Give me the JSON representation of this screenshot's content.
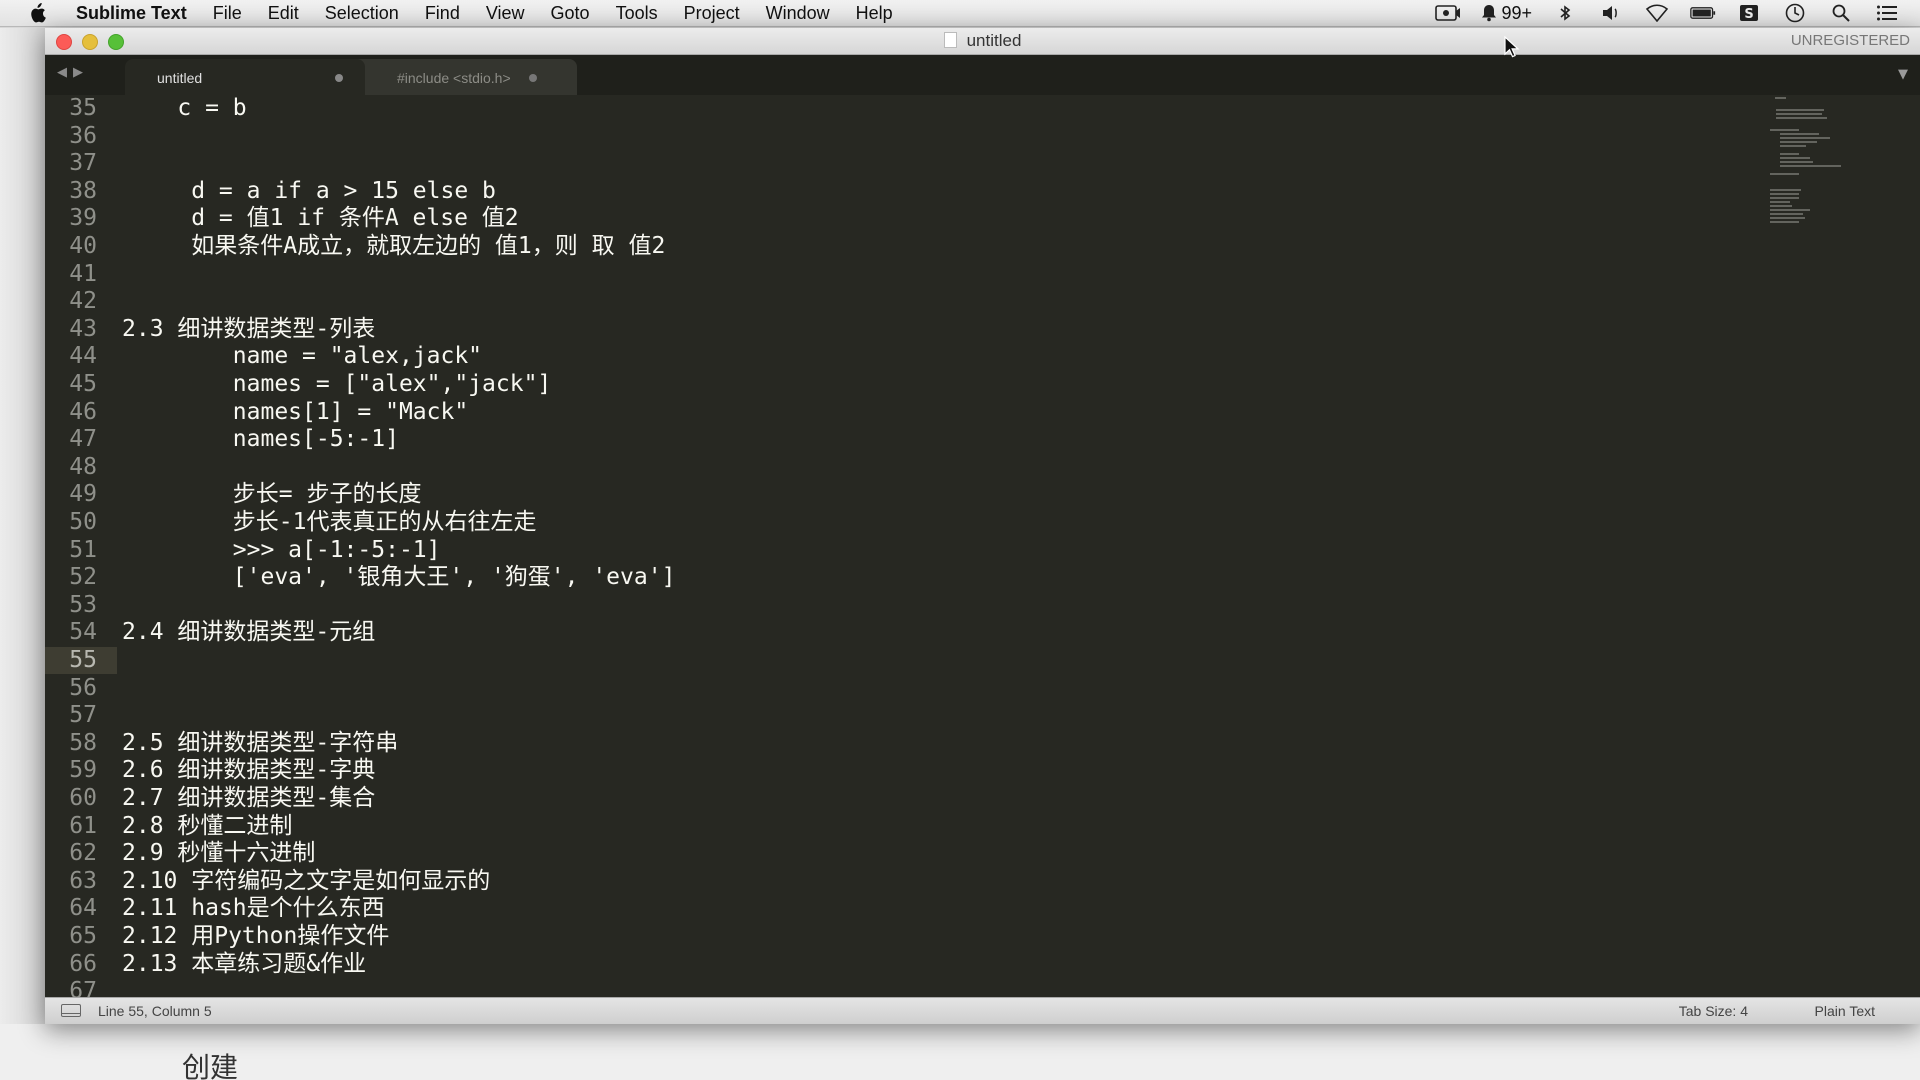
{
  "menubar": {
    "app_name": "Sublime Text",
    "items": [
      "File",
      "Edit",
      "Selection",
      "Find",
      "View",
      "Goto",
      "Tools",
      "Project",
      "Window",
      "Help"
    ],
    "status_icons": [
      "screen-record-icon",
      "notification-bell-icon",
      "bluetooth-icon",
      "volume-icon",
      "wifi-icon",
      "battery-icon",
      "s-app-icon",
      "clock-icon",
      "spotlight-search-icon",
      "notification-center-icon"
    ],
    "notification_count": "99+"
  },
  "window": {
    "title": "untitled",
    "registration": "UNREGISTERED"
  },
  "tabs": [
    {
      "label": "untitled",
      "active": true
    },
    {
      "label": "#include <stdio.h>",
      "active": false
    }
  ],
  "editor": {
    "current_line": 55,
    "lines": [
      {
        "n": "35",
        "text": "    c = b"
      },
      {
        "n": "36",
        "text": ""
      },
      {
        "n": "37",
        "text": ""
      },
      {
        "n": "38",
        "text": "     d = a if a > 15 else b"
      },
      {
        "n": "39",
        "text": "     d = 值1 if 条件A else 值2"
      },
      {
        "n": "40",
        "text": "     如果条件A成立，就取左边的 值1，则 取 值2"
      },
      {
        "n": "41",
        "text": ""
      },
      {
        "n": "42",
        "text": ""
      },
      {
        "n": "43",
        "text": "2.3 细讲数据类型-列表"
      },
      {
        "n": "44",
        "text": "        name = \"alex,jack\""
      },
      {
        "n": "45",
        "text": "        names = [\"alex\",\"jack\"]"
      },
      {
        "n": "46",
        "text": "        names[1] = \"Mack\""
      },
      {
        "n": "47",
        "text": "        names[-5:-1]"
      },
      {
        "n": "48",
        "text": ""
      },
      {
        "n": "49",
        "text": "        步长= 步子的长度"
      },
      {
        "n": "50",
        "text": "        步长-1代表真正的从右往左走"
      },
      {
        "n": "51",
        "text": "        >>> a[-1:-5:-1]"
      },
      {
        "n": "52",
        "text": "        ['eva', '银角大王', '狗蛋', 'eva']"
      },
      {
        "n": "53",
        "text": ""
      },
      {
        "n": "54",
        "text": "2.4 细讲数据类型-元组"
      },
      {
        "n": "55",
        "text": ""
      },
      {
        "n": "56",
        "text": ""
      },
      {
        "n": "57",
        "text": ""
      },
      {
        "n": "58",
        "text": "2.5 细讲数据类型-字符串"
      },
      {
        "n": "59",
        "text": "2.6 细讲数据类型-字典"
      },
      {
        "n": "60",
        "text": "2.7 细讲数据类型-集合"
      },
      {
        "n": "61",
        "text": "2.8 秒懂二进制"
      },
      {
        "n": "62",
        "text": "2.9 秒懂十六进制"
      },
      {
        "n": "63",
        "text": "2.10 字符编码之文字是如何显示的"
      },
      {
        "n": "64",
        "text": "2.11 hash是个什么东西"
      },
      {
        "n": "65",
        "text": "2.12 用Python操作文件"
      },
      {
        "n": "66",
        "text": "2.13 本章练习题&作业"
      },
      {
        "n": "67",
        "text": ""
      }
    ]
  },
  "statusbar": {
    "position": "Line 55, Column 5",
    "tab_size": "Tab Size: 4",
    "syntax": "Plain Text"
  },
  "background": {
    "bottom_text": "创建"
  },
  "colors": {
    "editor_bg": "#272822",
    "text": "#f8f8f2",
    "line_number": "#8f908a",
    "current_line": "#3e3d32"
  }
}
